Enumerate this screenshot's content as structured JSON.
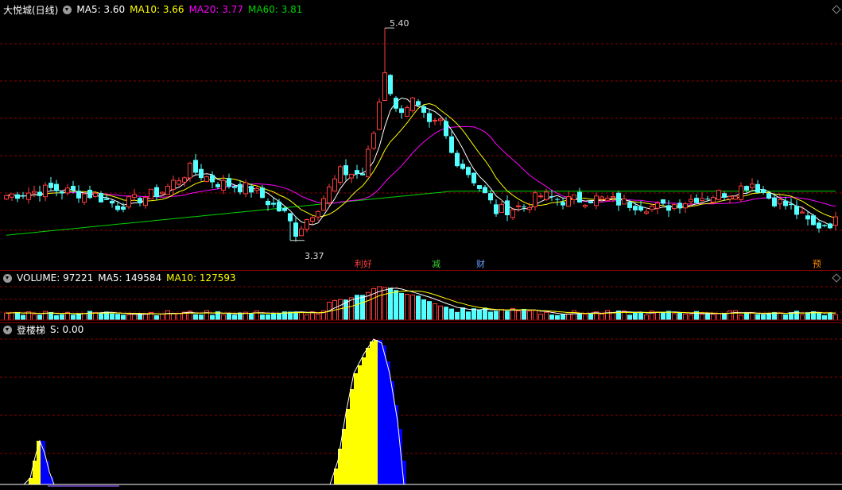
{
  "main": {
    "title": "大悦城(日线)",
    "ma5": "MA5: 3.60",
    "ma10": "MA10: 3.66",
    "ma20": "MA20: 3.77",
    "ma60": "MA60: 3.81",
    "high_label": "5.40",
    "low_label": "3.37",
    "tags": [
      "利好",
      "减",
      "财",
      "预"
    ]
  },
  "volume": {
    "vol": "VOLUME: 97221",
    "ma5": "MA5: 149584",
    "ma10": "MA10: 127593"
  },
  "indicator": {
    "name": "登楼梯",
    "value": "S: 0.00"
  },
  "colors": {
    "up": "#ff3c3c",
    "down": "#54ffff",
    "ma5": "#ffffff",
    "ma10": "#ffff00",
    "ma20": "#ff00ff",
    "ma60": "#00d400",
    "grid": "#8b0000",
    "stair_up": "#ffff00",
    "stair_down": "#0000ff"
  }
}
